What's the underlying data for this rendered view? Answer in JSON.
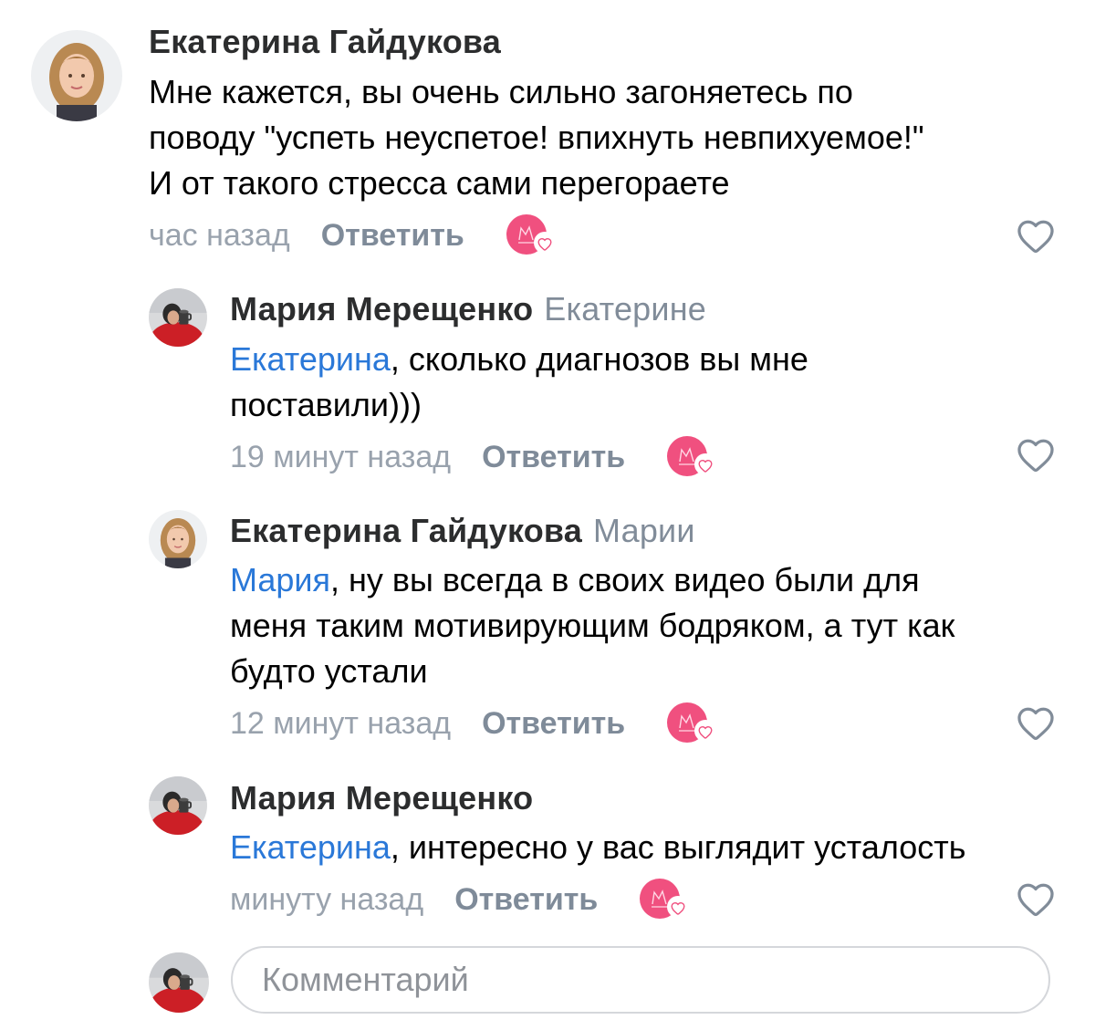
{
  "comments": [
    {
      "author": "Екатерина Гайдукова",
      "reply_to": "",
      "mention": "",
      "lines": [
        "Мне кажется, вы очень сильно загоняетесь по",
        "поводу \"успеть неуспетое! впихнуть невпихуемое!\"",
        "И от такого стресса сами перегораете"
      ],
      "time": "час назад",
      "reply_label": "Ответить"
    },
    {
      "author": "Мария Мерещенко",
      "reply_to": "Екатерине",
      "mention": "Екатерина",
      "lines": [
        ", сколько диагнозов вы мне",
        "поставили)))"
      ],
      "time": "19 минут назад",
      "reply_label": "Ответить"
    },
    {
      "author": "Екатерина Гайдукова",
      "reply_to": "Марии",
      "mention": "Мария",
      "lines": [
        ", ну вы всегда в своих видео были для",
        "меня таким мотивирующим бодряком, а тут как",
        "будто устали"
      ],
      "time": "12 минут назад",
      "reply_label": "Ответить"
    },
    {
      "author": "Мария Мерещенко",
      "reply_to": "",
      "mention": "Екатерина",
      "lines": [
        ", интересно у вас выглядит усталость"
      ],
      "time": "минуту назад",
      "reply_label": "Ответить"
    }
  ],
  "composer": {
    "placeholder": "Комментарий"
  },
  "icons": {
    "like": "heart-outline-icon",
    "reaction": "reaction-avatar-heart-icon"
  },
  "colors": {
    "mention": "#2a78d8",
    "secondary": "#818c99",
    "reaction_pink": "#f0507f"
  }
}
